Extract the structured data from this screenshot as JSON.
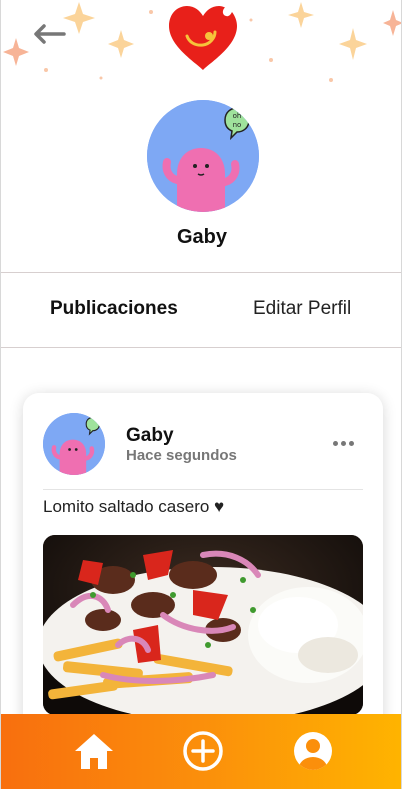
{
  "profile": {
    "name": "Gaby",
    "avatar_speech": "oh no"
  },
  "tabs": [
    {
      "label": "Publicaciones",
      "active": true
    },
    {
      "label": "Editar Perfil",
      "active": false
    }
  ],
  "post": {
    "user": "Gaby",
    "time": "Hace segundos",
    "text": "Lomito saltado casero ♥",
    "image": "lomito-saltado-photo"
  },
  "nav": {
    "items": [
      "home-icon",
      "add-icon",
      "profile-icon"
    ]
  },
  "colors": {
    "accent_start": "#f86f0e",
    "accent_end": "#ffb400",
    "logo_red": "#e8201a",
    "avatar_bg": "#7ea8f4"
  }
}
